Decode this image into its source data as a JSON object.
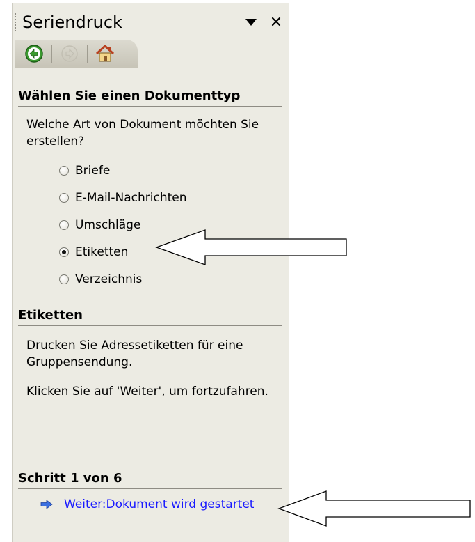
{
  "pane": {
    "title": "Seriendruck"
  },
  "section1": {
    "title": "Wählen Sie einen Dokumenttyp",
    "question": "Welche Art von Dokument möchten Sie erstellen?",
    "options": [
      {
        "label": "Briefe",
        "checked": false
      },
      {
        "label": "E-Mail-Nachrichten",
        "checked": false
      },
      {
        "label": "Umschläge",
        "checked": false
      },
      {
        "label": "Etiketten",
        "checked": true
      },
      {
        "label": "Verzeichnis",
        "checked": false
      }
    ]
  },
  "section2": {
    "title": "Etiketten",
    "desc1": "Drucken Sie Adressetiketten für eine Gruppensendung.",
    "desc2": "Klicken Sie auf 'Weiter', um fortzufahren."
  },
  "section3": {
    "title": "Schritt 1 von 6",
    "next_link": "Weiter:Dokument wird gestartet"
  },
  "colors": {
    "pane_bg": "#ecebe3",
    "link": "#1a1aff",
    "nav_back_green": "#3a9a2e"
  },
  "icons": [
    "grip-icon",
    "dropdown-arrow-icon",
    "close-icon",
    "back-arrow-icon",
    "forward-arrow-icon",
    "home-icon",
    "blue-arrow-icon",
    "callout-arrow"
  ]
}
